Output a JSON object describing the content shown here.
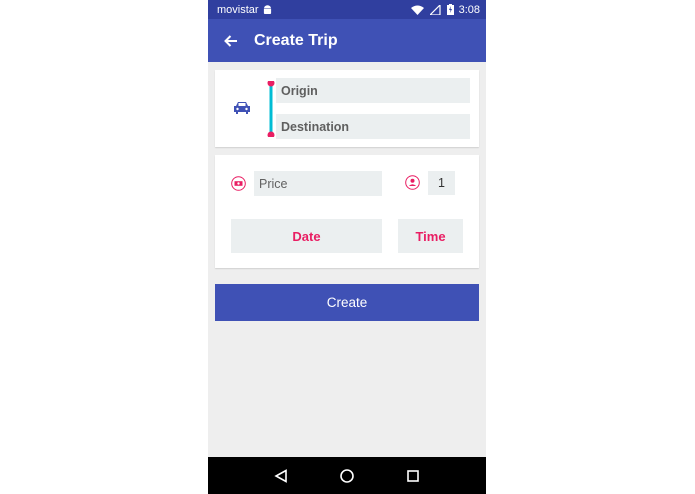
{
  "colors": {
    "primary": "#3f51b5",
    "primary_dark": "#303f9f",
    "accent": "#e91e63",
    "route_line": "#00bcd4",
    "background": "#eeeeee"
  },
  "status_bar": {
    "carrier": "movistar",
    "time": "3:08",
    "icons": [
      "android-icon",
      "wifi-icon",
      "no-signal-icon",
      "battery-charging-icon"
    ]
  },
  "app_bar": {
    "title": "Create Trip",
    "back_icon": "arrow-back-icon"
  },
  "route": {
    "vehicle_icon": "car-icon",
    "origin_placeholder": "Origin",
    "destination_placeholder": "Destination"
  },
  "details": {
    "price_icon": "money-icon",
    "price_placeholder": "Price",
    "seats_icon": "person-icon",
    "seats_value": "1",
    "date_label": "Date",
    "time_label": "Time"
  },
  "actions": {
    "create_label": "Create"
  },
  "nav_bar": {
    "icons": [
      "back-triangle-icon",
      "home-circle-icon",
      "recents-square-icon"
    ]
  }
}
